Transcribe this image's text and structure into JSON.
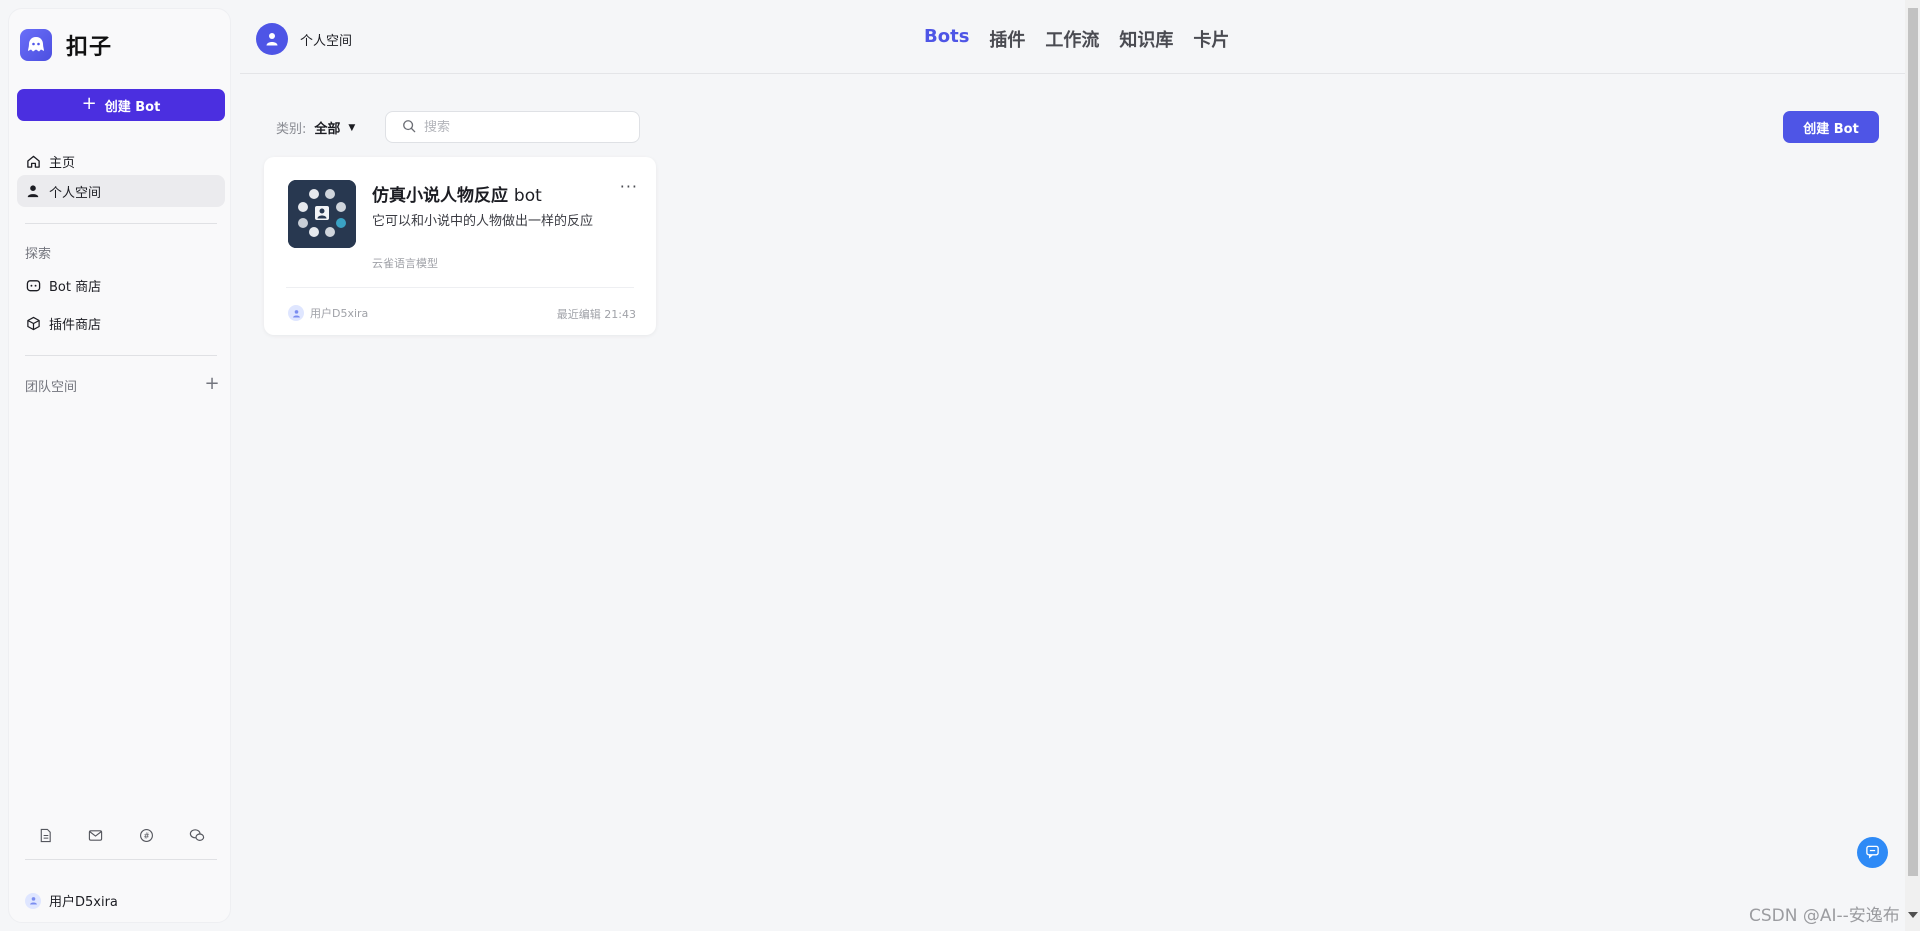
{
  "sidebar": {
    "brand_name": "扣子",
    "create_bot_label": "创建 Bot",
    "nav_items": [
      {
        "label": "主页",
        "icon": "home-icon"
      },
      {
        "label": "个人空间",
        "icon": "user-icon",
        "active": true
      }
    ],
    "explore_label": "探索",
    "explore_items": [
      {
        "label": "Bot 商店",
        "icon": "bot-icon"
      },
      {
        "label": "插件商店",
        "icon": "cube-icon"
      }
    ],
    "team_space_label": "团队空间",
    "footer_icons": [
      "document-icon",
      "mail-icon",
      "discord-icon",
      "wechat-icon"
    ],
    "user_name": "用户D5xira"
  },
  "header": {
    "space_title": "个人空间",
    "tabs": [
      {
        "label": "Bots",
        "active": true
      },
      {
        "label": "插件"
      },
      {
        "label": "工作流"
      },
      {
        "label": "知识库"
      },
      {
        "label": "卡片"
      }
    ]
  },
  "toolbar": {
    "filter_label": "类别:",
    "filter_value": "全部",
    "search_placeholder": "搜索",
    "create_bot_label": "创建 Bot"
  },
  "bots": [
    {
      "title": "仿真小说人物反应",
      "title_suffix": "bot",
      "description": "它可以和小说中的人物做出一样的反应",
      "model": "云雀语言模型",
      "owner": "用户D5xira",
      "last_edited": "最近编辑 21:43"
    }
  ],
  "watermark": "CSDN @AI--安逸布",
  "colors": {
    "brand": "#4b2fe0",
    "accent": "#4e55e6",
    "help_button": "#2e8af6"
  }
}
